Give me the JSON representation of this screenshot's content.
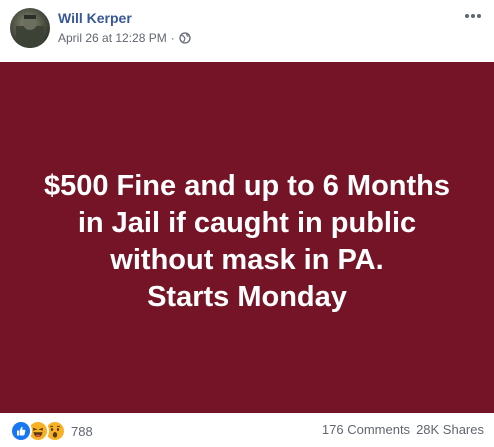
{
  "post": {
    "author": "Will Kerper",
    "timestamp": "April 26 at 12:28 PM",
    "separator": "·",
    "privacy_icon": "globe-icon",
    "more_icon": "more-options-icon"
  },
  "image": {
    "background_color": "#741426",
    "lines": [
      "$500 Fine and up to 6 Months",
      "in Jail if caught in public",
      "without mask in PA.",
      "Starts Monday"
    ]
  },
  "footer": {
    "reaction_icons": [
      "like-icon",
      "haha-icon",
      "wow-icon"
    ],
    "reaction_count": "788",
    "comments": "176 Comments",
    "shares": "28K Shares"
  },
  "colors": {
    "name_link": "#385898",
    "meta_text": "#606770",
    "like_blue": "#1877f2",
    "emoji_yellow": "#f7b125"
  }
}
